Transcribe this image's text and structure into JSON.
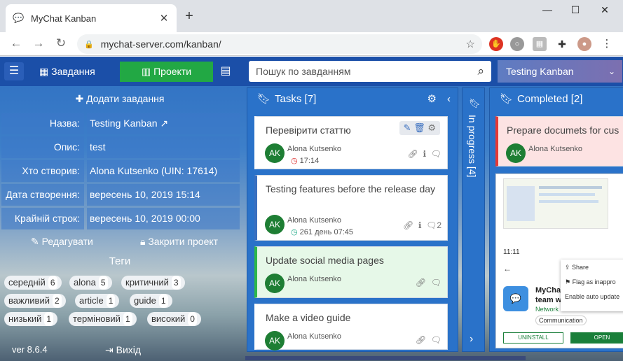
{
  "browser": {
    "tab_title": "MyChat Kanban",
    "url": "mychat-server.com/kanban/"
  },
  "nav": {
    "tasks_label": "Завдання",
    "projects_label": "Проекти",
    "search_placeholder": "Пошук по завданням",
    "project_selected": "Testing Kanban"
  },
  "sidebar": {
    "add_task": "Додати завдання",
    "fields": [
      {
        "label": "Назва:",
        "value": "Testing Kanban"
      },
      {
        "label": "Опис:",
        "value": "test"
      },
      {
        "label": "Хто створив:",
        "value": "Alona Kutsenko (UIN: 17614)"
      },
      {
        "label": "Дата створення:",
        "value": "вересень 10, 2019 15:14"
      },
      {
        "label": "Крайній строк:",
        "value": "вересень 10, 2019 00:00"
      }
    ],
    "edit": "Редагувати",
    "close_project": "Закрити проект",
    "tags_title": "Теги",
    "tags": [
      {
        "name": "середній",
        "count": "6"
      },
      {
        "name": "alona",
        "count": "5"
      },
      {
        "name": "критичний",
        "count": "3"
      },
      {
        "name": "важливий",
        "count": "2"
      },
      {
        "name": "article",
        "count": "1"
      },
      {
        "name": "guide",
        "count": "1"
      },
      {
        "name": "низький",
        "count": "1"
      },
      {
        "name": "терміновий",
        "count": "1"
      },
      {
        "name": "високий",
        "count": "0"
      }
    ],
    "version": "ver 8.6.4",
    "logout": "Вихід"
  },
  "columns": {
    "tasks": {
      "title": "Tasks [7]"
    },
    "in_progress": {
      "title": "In progress [4]"
    },
    "completed": {
      "title": "Completed [2]"
    }
  },
  "cards": [
    {
      "title": "Перевірити статтю",
      "avatar": "AK",
      "author": "Alona Kutsenko",
      "time": "17:14",
      "accent": "#ffffff"
    },
    {
      "title": "Testing features before the release day",
      "avatar": "AK",
      "author": "Alona Kutsenko",
      "time": "261 день 07:45",
      "comments": "2",
      "accent": "#3a6fbf"
    },
    {
      "title": "Update social media pages",
      "avatar": "AK",
      "author": "Alona Kutsenko",
      "accent": "#2db84a"
    },
    {
      "title": "Make a video guide",
      "avatar": "AK",
      "author": "Alona Kutsenko",
      "accent": "#ffffff"
    }
  ],
  "completed_cards": [
    {
      "title": "Prepare documets for cus",
      "avatar": "AK",
      "author": "Alona Kutsenko",
      "accent": "#e53935"
    }
  ],
  "preview": {
    "time": "11:11",
    "share": "Share",
    "flag": "Flag as inappro",
    "auto": "Enable auto update",
    "app": "MyChat",
    "app2": "team wo",
    "dev": "Network Sc",
    "category": "Communication",
    "uninstall": "UNINSTALL",
    "open": "OPEN"
  }
}
